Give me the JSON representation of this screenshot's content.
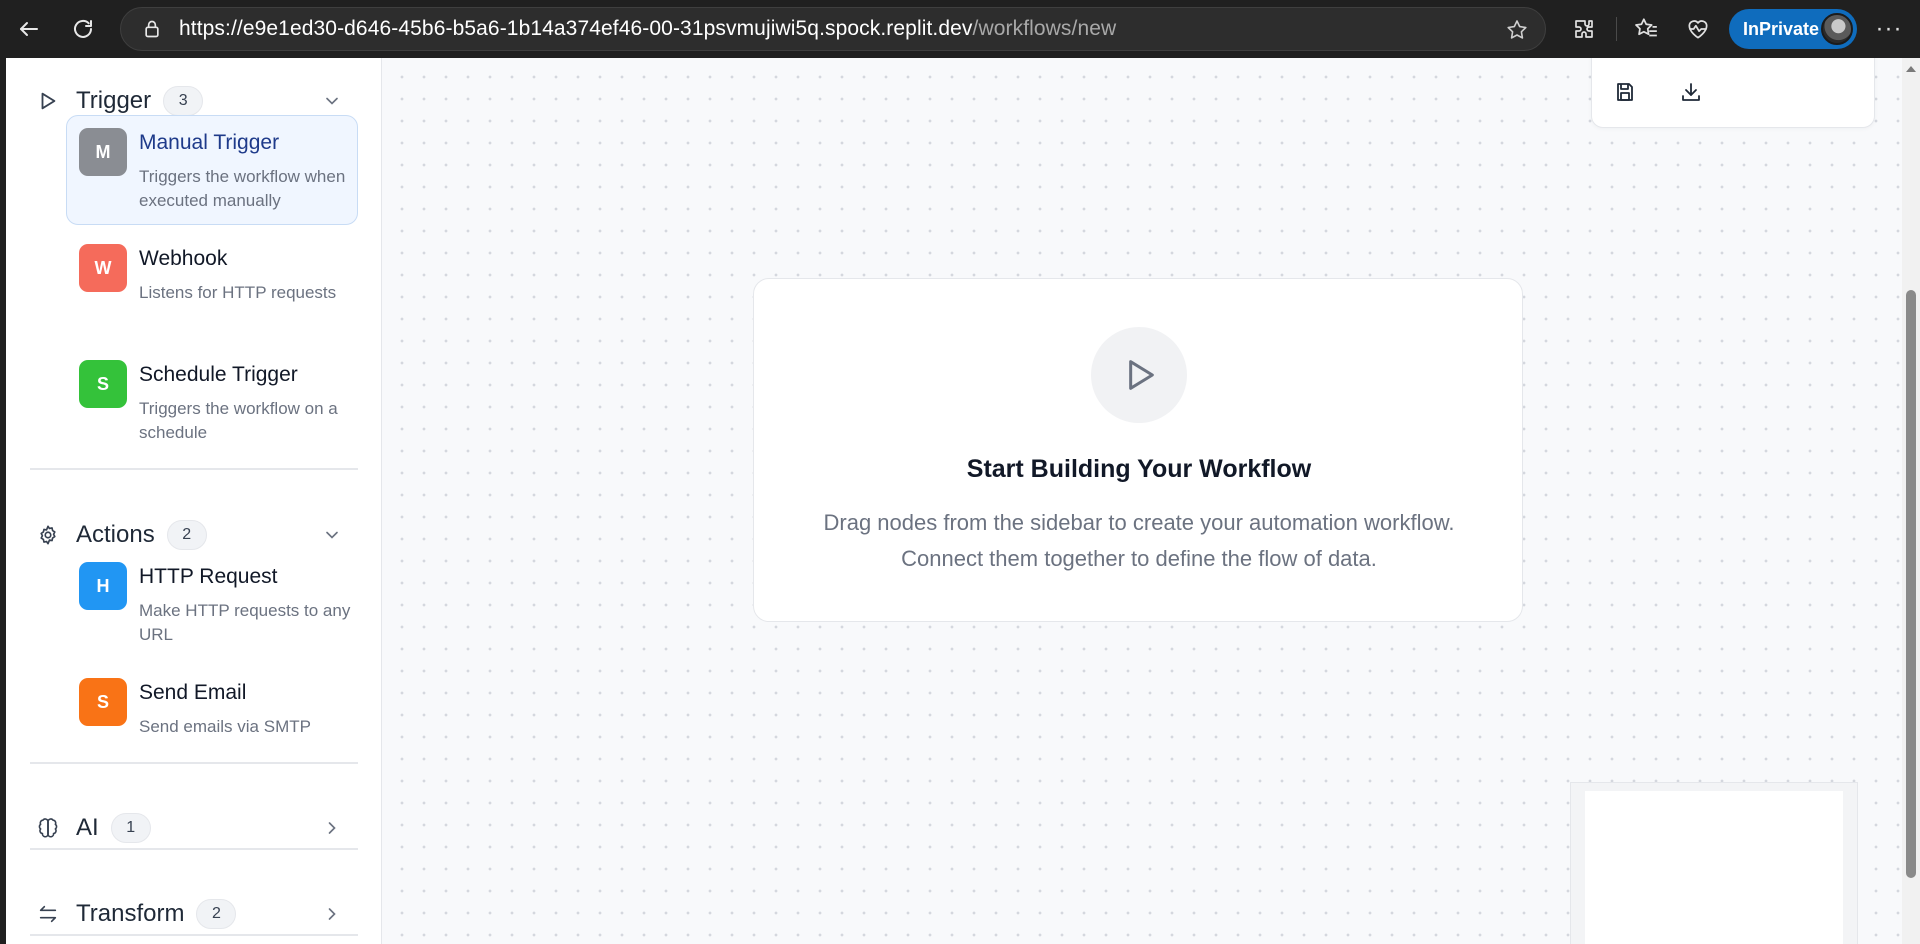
{
  "browser": {
    "url_host": "https://e9e1ed30-d646-45b6-b5a6-1b14a374ef46-00-31psvmujiwi5q.spock.replit.dev",
    "url_path": "/workflows/new",
    "inprivate_label": "InPrivate",
    "accent_color": "#0f6cbd"
  },
  "sidebar": {
    "sections": [
      {
        "title": "Trigger",
        "count": "3",
        "icon": "play-outline-icon",
        "expanded": true,
        "items": [
          {
            "tile": "M",
            "name": "Manual Trigger",
            "desc": "Triggers the workflow when executed manually",
            "color": "#8a8d93",
            "selected": true
          },
          {
            "tile": "W",
            "name": "Webhook",
            "desc": "Listens for HTTP requests",
            "color": "#f56b5b"
          },
          {
            "tile": "S",
            "name": "Schedule Trigger",
            "desc": "Triggers the workflow on a schedule",
            "color": "#34c23a"
          }
        ]
      },
      {
        "title": "Actions",
        "count": "2",
        "icon": "gear-icon",
        "expanded": true,
        "items": [
          {
            "tile": "H",
            "name": "HTTP Request",
            "desc": "Make HTTP requests to any URL",
            "color": "#2196f3"
          },
          {
            "tile": "S",
            "name": "Send Email",
            "desc": "Send emails via SMTP",
            "color": "#f97316"
          }
        ]
      },
      {
        "title": "AI",
        "count": "1",
        "icon": "brain-icon",
        "expanded": false
      },
      {
        "title": "Transform",
        "count": "2",
        "icon": "arrows-swap-icon",
        "expanded": false
      }
    ]
  },
  "canvas": {
    "toolbar": {
      "save_icon": "save-icon",
      "export_icon": "download-icon"
    },
    "empty_state": {
      "icon": "play-icon",
      "title": "Start Building Your Workflow",
      "description": "Drag nodes from the sidebar to create your automation workflow. Connect them together to define the flow of data."
    }
  }
}
